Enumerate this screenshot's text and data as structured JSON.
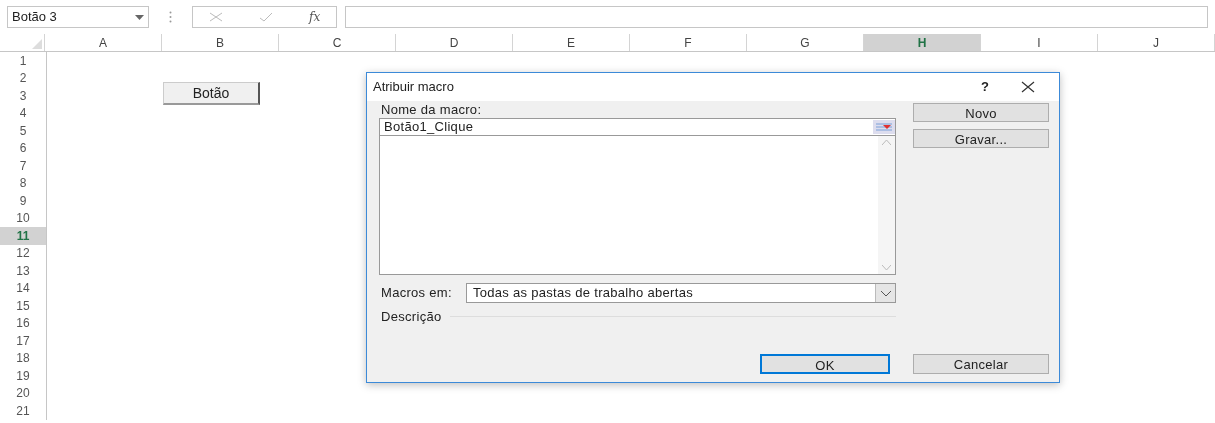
{
  "formula_bar": {
    "name_box": "Botão 3",
    "function_label": "fx"
  },
  "columns": [
    {
      "label": "A",
      "selected": false
    },
    {
      "label": "B",
      "selected": false
    },
    {
      "label": "C",
      "selected": false
    },
    {
      "label": "D",
      "selected": false
    },
    {
      "label": "E",
      "selected": false
    },
    {
      "label": "F",
      "selected": false
    },
    {
      "label": "G",
      "selected": false
    },
    {
      "label": "H",
      "selected": true
    },
    {
      "label": "I",
      "selected": false
    },
    {
      "label": "J",
      "selected": false
    }
  ],
  "rows": [
    {
      "label": "1",
      "selected": false
    },
    {
      "label": "2",
      "selected": false
    },
    {
      "label": "3",
      "selected": false
    },
    {
      "label": "4",
      "selected": false
    },
    {
      "label": "5",
      "selected": false
    },
    {
      "label": "6",
      "selected": false
    },
    {
      "label": "7",
      "selected": false
    },
    {
      "label": "8",
      "selected": false
    },
    {
      "label": "9",
      "selected": false
    },
    {
      "label": "10",
      "selected": false
    },
    {
      "label": "11",
      "selected": true
    },
    {
      "label": "12",
      "selected": false
    },
    {
      "label": "13",
      "selected": false
    },
    {
      "label": "14",
      "selected": false
    },
    {
      "label": "15",
      "selected": false
    },
    {
      "label": "16",
      "selected": false
    },
    {
      "label": "17",
      "selected": false
    },
    {
      "label": "18",
      "selected": false
    },
    {
      "label": "19",
      "selected": false
    },
    {
      "label": "20",
      "selected": false
    },
    {
      "label": "21",
      "selected": false
    }
  ],
  "sheet_button": {
    "label": "Botão"
  },
  "dialog": {
    "title": "Atribuir macro",
    "help": "?",
    "macro_name_label": "Nome da macro:",
    "macro_name_value": "Botão1_Clique",
    "macros_in_label": "Macros em:",
    "macros_in_value": "Todas as pastas de trabalho abertas",
    "description_label": "Descrição",
    "side_buttons": [
      {
        "label": "Novo"
      },
      {
        "label": "Gravar..."
      }
    ],
    "footer_buttons": [
      {
        "label": "OK",
        "default": true
      },
      {
        "label": "Cancelar",
        "default": false
      }
    ]
  }
}
